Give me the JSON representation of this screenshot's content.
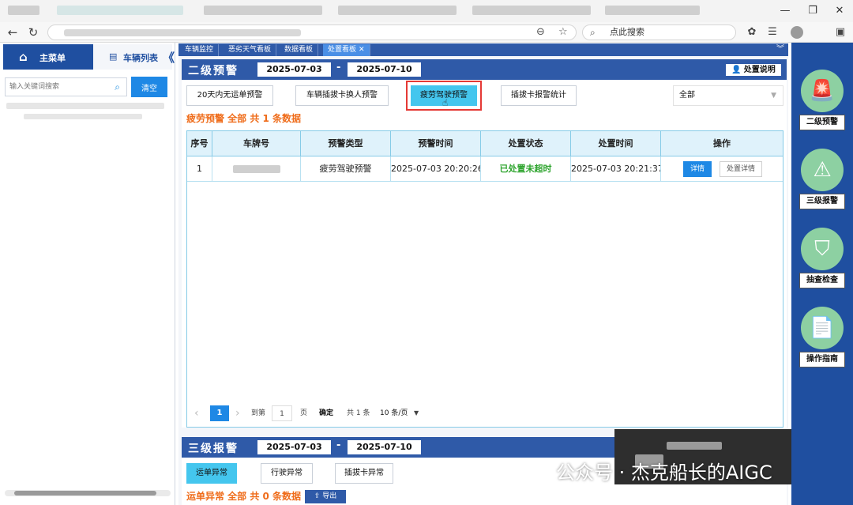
{
  "browser": {
    "search_placeholder": "点此搜索"
  },
  "sidebar": {
    "main_menu": "主菜单",
    "vehicle_list": "车辆列表",
    "collapse_glyph": "《",
    "search_placeholder": "输入关键词搜索",
    "clear_label": "清空"
  },
  "page_tabs": [
    {
      "label": "车辆监控"
    },
    {
      "label": "恶劣天气看板"
    },
    {
      "label": "数据看板"
    },
    {
      "label": "处置看板"
    }
  ],
  "level2": {
    "title": "二级预警",
    "date_from": "2025-07-03",
    "date_sep": "-",
    "date_to": "2025-07-10",
    "help_label": "处置说明",
    "filters": [
      "20天内无运单预警",
      "车辆插拔卡换人预警",
      "疲劳驾驶预警",
      "插拔卡报警统计"
    ],
    "active_filter_index": 2,
    "select_value": "全部",
    "summary": "疲劳预警 全部 共 1 条数据",
    "columns": [
      "序号",
      "车牌号",
      "预警类型",
      "预警时间",
      "处置状态",
      "处置时间",
      "操作"
    ],
    "rows": [
      {
        "index": "1",
        "type": "疲劳驾驶预警",
        "alert_time": "2025-07-03 20:20:26",
        "status": "已处置未超时",
        "handle_time": "2025-07-03 20:21:37",
        "detail_label": "详情",
        "handle_detail_label": "处置详情"
      }
    ],
    "pager": {
      "prev": "‹",
      "current": "1",
      "next": "›",
      "goto_label": "到第",
      "goto_value": "1",
      "page_unit": "页",
      "confirm": "确定",
      "total": "共 1 条",
      "page_size": "10 条/页"
    }
  },
  "level3": {
    "title": "三级报警",
    "date_from": "2025-07-03",
    "date_sep": "-",
    "date_to": "2025-07-10",
    "filters": [
      "运单异常",
      "行驶异常",
      "插拔卡异常"
    ],
    "active_filter_index": 0,
    "summary": "运单异常 全部 共 0 条数据",
    "export_label": "导出"
  },
  "rail": [
    {
      "label": "二级预警",
      "icon": "alarm-light-icon"
    },
    {
      "label": "三级报警",
      "icon": "warning-triangle-icon"
    },
    {
      "label": "抽查检查",
      "icon": "shield-search-icon"
    },
    {
      "label": "操作指南",
      "icon": "document-pointer-icon"
    }
  ],
  "watermark": {
    "text": "公众号 · 杰克船长的AIGC"
  },
  "colors": {
    "header_blue": "#2f5aa8",
    "accent_cyan": "#44c6ee",
    "primary_blue": "#1e88e5",
    "summary_orange": "#ef6c1a",
    "status_green": "#2ea42e",
    "rail_icon_green": "#8dd0a2",
    "highlight_red": "#e53935"
  }
}
